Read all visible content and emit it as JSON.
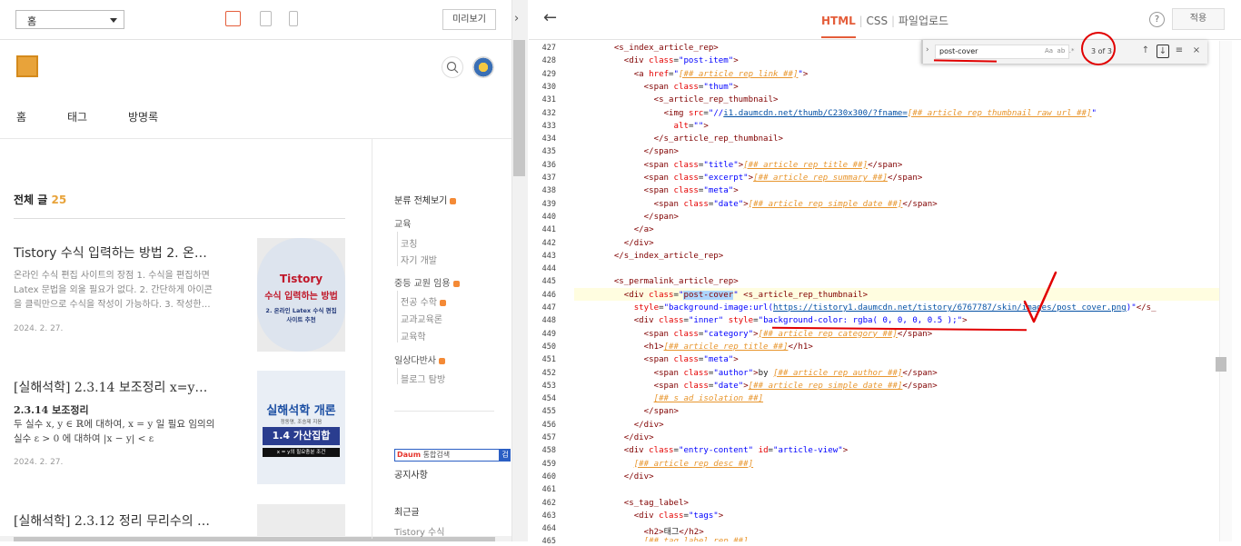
{
  "left": {
    "page_select": "홈",
    "preview_label": "미리보기",
    "nav": [
      "홈",
      "태그",
      "방명록"
    ],
    "total_label": "전체 글",
    "total_count": "25",
    "posts": [
      {
        "title": "Tistory 수식 입력하는 방법 2. 온…",
        "excerpt": "온라인 수식 편집 사이트의 장점 1. 수식을 편집하면 Latex 문법을 외울 필요가 없다. 2. 간단하게 아이콘을 클릭만으로 수식을 작성이 가능하다. 3. 작성한…",
        "date": "2024. 2. 27.",
        "thumb_line1": "Tistory",
        "thumb_line2": "수식 입력하는 방법",
        "thumb_line3": "2. 온라인 Latex 수식 편집 사이트 추천"
      },
      {
        "title": "[실해석학] 2.3.14 보조정리 x=y…",
        "excerpt_title": "2.3.14 보조정리",
        "excerpt": "두 실수 x, y ∈ ℝ에 대하여, x = y 일 필요 임의의 실수 ε > 0 에 대하여 |x − y| < ε",
        "date": "2024. 2. 27.",
        "thumb_line1": "실해석학 개론",
        "thumb_line2": "정동명, 조승제 지음",
        "thumb_line3": "1.4 가산집합",
        "thumb_line4": "x = y의 필요충분 조건"
      },
      {
        "title": "[실해석학] 2.3.12 정리 무리수의 …"
      }
    ],
    "sidebar": {
      "category_all": "분류 전체보기",
      "groups": [
        {
          "label": "교육",
          "items": [
            "코칭",
            "자기 개발"
          ]
        },
        {
          "label": "중등 교원 임용",
          "items": [
            "전공 수학",
            "교과교육론",
            "교육학"
          ]
        },
        {
          "label": "일상다반사",
          "items": [
            "블로그 탐방"
          ]
        }
      ],
      "search_placeholder": "통합검색",
      "search_btn": "검",
      "notice": "공지사항",
      "recent": "최근글",
      "recent_item": "Tistory 수식"
    }
  },
  "editor": {
    "tabs": [
      "HTML",
      "CSS",
      "파일업로드"
    ],
    "active_tab": "HTML",
    "help": "?",
    "apply_label": "적용",
    "find": {
      "query": "post-cover",
      "count": "3 of 3",
      "opt_case": "Aa",
      "opt_word": "ab",
      "opt_regex": ".*"
    },
    "lines": [
      {
        "n": "427",
        "code": [
          [
            "p",
            "        "
          ],
          [
            "t",
            "<s_index_article_rep>"
          ]
        ]
      },
      {
        "n": "428",
        "code": [
          [
            "p",
            "          "
          ],
          [
            "t",
            "<div "
          ],
          [
            "a",
            "class"
          ],
          [
            "p",
            "="
          ],
          [
            "v",
            "\"post-item\""
          ],
          [
            "t",
            ">"
          ]
        ]
      },
      {
        "n": "429",
        "code": [
          [
            "p",
            "            "
          ],
          [
            "t",
            "<a "
          ],
          [
            "a",
            "href"
          ],
          [
            "p",
            "="
          ],
          [
            "v",
            "\""
          ],
          [
            "o",
            "[##_article_rep_link_##]"
          ],
          [
            "v",
            "\""
          ],
          [
            "t",
            ">"
          ]
        ]
      },
      {
        "n": "430",
        "code": [
          [
            "p",
            "              "
          ],
          [
            "t",
            "<span "
          ],
          [
            "a",
            "class"
          ],
          [
            "p",
            "="
          ],
          [
            "v",
            "\"thum\""
          ],
          [
            "t",
            ">"
          ]
        ]
      },
      {
        "n": "431",
        "code": [
          [
            "p",
            "                "
          ],
          [
            "t",
            "<s_article_rep_thumbnail>"
          ]
        ]
      },
      {
        "n": "432",
        "code": [
          [
            "p",
            "                  "
          ],
          [
            "t",
            "<img "
          ],
          [
            "a",
            "src"
          ],
          [
            "p",
            "="
          ],
          [
            "v",
            "\"//"
          ],
          [
            "u",
            "i1.daumcdn.net/thumb/C230x300/?fname="
          ],
          [
            "o",
            "[##_article_rep_thumbnail_raw_url_##]"
          ],
          [
            "v",
            "\""
          ]
        ]
      },
      {
        "n": "433",
        "code": [
          [
            "p",
            "                    "
          ],
          [
            "a",
            "alt"
          ],
          [
            "p",
            "="
          ],
          [
            "v",
            "\"\""
          ],
          [
            "t",
            ">"
          ]
        ]
      },
      {
        "n": "434",
        "code": [
          [
            "p",
            "                "
          ],
          [
            "t",
            "</s_article_rep_thumbnail>"
          ]
        ]
      },
      {
        "n": "435",
        "code": [
          [
            "p",
            "              "
          ],
          [
            "t",
            "</span>"
          ]
        ]
      },
      {
        "n": "436",
        "code": [
          [
            "p",
            "              "
          ],
          [
            "t",
            "<span "
          ],
          [
            "a",
            "class"
          ],
          [
            "p",
            "="
          ],
          [
            "v",
            "\"title\""
          ],
          [
            "t",
            ">"
          ],
          [
            "o",
            "[##_article_rep_title_##]"
          ],
          [
            "t",
            "</span>"
          ]
        ]
      },
      {
        "n": "437",
        "code": [
          [
            "p",
            "              "
          ],
          [
            "t",
            "<span "
          ],
          [
            "a",
            "class"
          ],
          [
            "p",
            "="
          ],
          [
            "v",
            "\"excerpt\""
          ],
          [
            "t",
            ">"
          ],
          [
            "o",
            "[##_article_rep_summary_##]"
          ],
          [
            "t",
            "</span>"
          ]
        ]
      },
      {
        "n": "438",
        "code": [
          [
            "p",
            "              "
          ],
          [
            "t",
            "<span "
          ],
          [
            "a",
            "class"
          ],
          [
            "p",
            "="
          ],
          [
            "v",
            "\"meta\""
          ],
          [
            "t",
            ">"
          ]
        ]
      },
      {
        "n": "439",
        "code": [
          [
            "p",
            "                "
          ],
          [
            "t",
            "<span "
          ],
          [
            "a",
            "class"
          ],
          [
            "p",
            "="
          ],
          [
            "v",
            "\"date\""
          ],
          [
            "t",
            ">"
          ],
          [
            "o",
            "[##_article_rep_simple_date_##]"
          ],
          [
            "t",
            "</span>"
          ]
        ]
      },
      {
        "n": "440",
        "code": [
          [
            "p",
            "              "
          ],
          [
            "t",
            "</span>"
          ]
        ]
      },
      {
        "n": "441",
        "code": [
          [
            "p",
            "            "
          ],
          [
            "t",
            "</a>"
          ]
        ]
      },
      {
        "n": "442",
        "code": [
          [
            "p",
            "          "
          ],
          [
            "t",
            "</div>"
          ]
        ]
      },
      {
        "n": "443",
        "code": [
          [
            "p",
            "        "
          ],
          [
            "t",
            "</s_index_article_rep>"
          ]
        ]
      },
      {
        "n": "444",
        "code": [
          [
            "p",
            ""
          ]
        ]
      },
      {
        "n": "445",
        "code": [
          [
            "p",
            "        "
          ],
          [
            "t",
            "<s_permalink_article_rep>"
          ]
        ]
      },
      {
        "n": "446",
        "code": [
          [
            "p",
            "          "
          ],
          [
            "t",
            "<div "
          ],
          [
            "a",
            "class"
          ],
          [
            "p",
            "="
          ],
          [
            "v",
            "\""
          ],
          [
            "hl",
            "post-cover"
          ],
          [
            "v",
            "\""
          ],
          [
            "t",
            " <s_article_rep_thumbnail>"
          ]
        ]
      },
      {
        "n": "447",
        "code": [
          [
            "p",
            "            "
          ],
          [
            "a",
            "style"
          ],
          [
            "p",
            "="
          ],
          [
            "v",
            "\"background-image:url("
          ],
          [
            "u",
            "https://tistory1.daumcdn.net/tistory/6767787/skin/images/post_cover.png"
          ],
          [
            "v",
            ")\""
          ],
          [
            "t",
            "</s_"
          ]
        ]
      },
      {
        "n": "448",
        "code": [
          [
            "p",
            "            "
          ],
          [
            "t",
            "<div "
          ],
          [
            "a",
            "class"
          ],
          [
            "p",
            "="
          ],
          [
            "v",
            "\"inner\""
          ],
          [
            "p",
            " "
          ],
          [
            "a",
            "style"
          ],
          [
            "p",
            "="
          ],
          [
            "v",
            "\"background-color: rgba( 0, 0, 0, 0.5 );\""
          ],
          [
            "t",
            ">"
          ]
        ]
      },
      {
        "n": "449",
        "code": [
          [
            "p",
            "              "
          ],
          [
            "t",
            "<span "
          ],
          [
            "a",
            "class"
          ],
          [
            "p",
            "="
          ],
          [
            "v",
            "\"category\""
          ],
          [
            "t",
            ">"
          ],
          [
            "o",
            "[##_article_rep_category_##]"
          ],
          [
            "t",
            "</span>"
          ]
        ]
      },
      {
        "n": "450",
        "code": [
          [
            "p",
            "              "
          ],
          [
            "t",
            "<h1>"
          ],
          [
            "o",
            "[##_article_rep_title_##]"
          ],
          [
            "t",
            "</h1>"
          ]
        ]
      },
      {
        "n": "451",
        "code": [
          [
            "p",
            "              "
          ],
          [
            "t",
            "<span "
          ],
          [
            "a",
            "class"
          ],
          [
            "p",
            "="
          ],
          [
            "v",
            "\"meta\""
          ],
          [
            "t",
            ">"
          ]
        ]
      },
      {
        "n": "452",
        "code": [
          [
            "p",
            "                "
          ],
          [
            "t",
            "<span "
          ],
          [
            "a",
            "class"
          ],
          [
            "p",
            "="
          ],
          [
            "v",
            "\"author\""
          ],
          [
            "t",
            ">"
          ],
          [
            "k",
            "by "
          ],
          [
            "o",
            "[##_article_rep_author_##]"
          ],
          [
            "t",
            "</span>"
          ]
        ]
      },
      {
        "n": "453",
        "code": [
          [
            "p",
            "                "
          ],
          [
            "t",
            "<span "
          ],
          [
            "a",
            "class"
          ],
          [
            "p",
            "="
          ],
          [
            "v",
            "\"date\""
          ],
          [
            "t",
            ">"
          ],
          [
            "o",
            "[##_article_rep_simple_date_##]"
          ],
          [
            "t",
            "</span>"
          ]
        ]
      },
      {
        "n": "454",
        "code": [
          [
            "p",
            "                "
          ],
          [
            "o",
            "[##_s_ad_isolation_##]"
          ]
        ]
      },
      {
        "n": "455",
        "code": [
          [
            "p",
            "              "
          ],
          [
            "t",
            "</span>"
          ]
        ]
      },
      {
        "n": "456",
        "code": [
          [
            "p",
            "            "
          ],
          [
            "t",
            "</div>"
          ]
        ]
      },
      {
        "n": "457",
        "code": [
          [
            "p",
            "          "
          ],
          [
            "t",
            "</div>"
          ]
        ]
      },
      {
        "n": "458",
        "code": [
          [
            "p",
            "          "
          ],
          [
            "t",
            "<div "
          ],
          [
            "a",
            "class"
          ],
          [
            "p",
            "="
          ],
          [
            "v",
            "\"entry-content\""
          ],
          [
            "p",
            " "
          ],
          [
            "a",
            "id"
          ],
          [
            "p",
            "="
          ],
          [
            "v",
            "\"article-view\""
          ],
          [
            "t",
            ">"
          ]
        ]
      },
      {
        "n": "459",
        "code": [
          [
            "p",
            "            "
          ],
          [
            "o",
            "[##_article_rep_desc_##]"
          ]
        ]
      },
      {
        "n": "460",
        "code": [
          [
            "p",
            "          "
          ],
          [
            "t",
            "</div>"
          ]
        ]
      },
      {
        "n": "461",
        "code": [
          [
            "p",
            ""
          ]
        ]
      },
      {
        "n": "462",
        "code": [
          [
            "p",
            "          "
          ],
          [
            "t",
            "<s_tag_label>"
          ]
        ]
      },
      {
        "n": "463",
        "code": [
          [
            "p",
            "            "
          ],
          [
            "t",
            "<div "
          ],
          [
            "a",
            "class"
          ],
          [
            "p",
            "="
          ],
          [
            "v",
            "\"tags\""
          ],
          [
            "t",
            ">"
          ]
        ]
      },
      {
        "n": "464",
        "code": [
          [
            "p",
            "              "
          ],
          [
            "t",
            "<h2>"
          ],
          [
            "k",
            "태그"
          ],
          [
            "t",
            "</h2>"
          ]
        ]
      },
      {
        "n": "465",
        "code": [
          [
            "p",
            "              "
          ],
          [
            "o",
            "[##_tag_label_rep_##]"
          ]
        ]
      }
    ]
  },
  "colors": {
    "accent": "#e45d3a",
    "annotation": "#e10000",
    "tag": "#800000",
    "attr": "#e50000",
    "value": "#0000ff"
  }
}
